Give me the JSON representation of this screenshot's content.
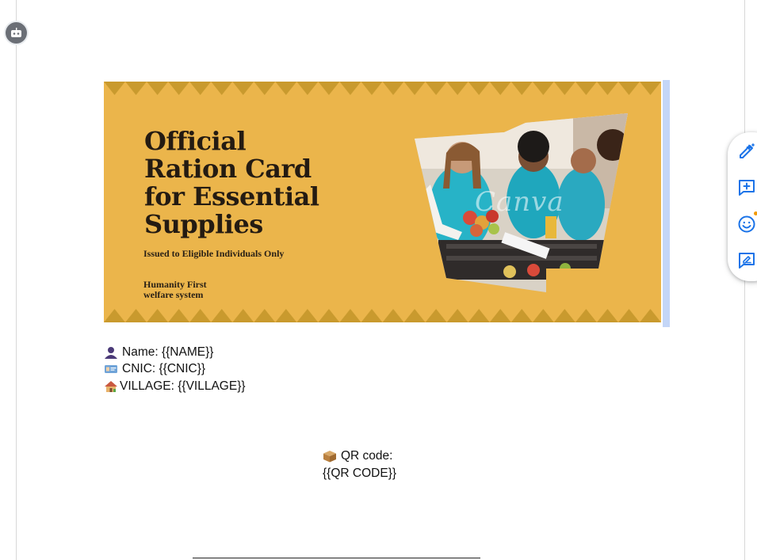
{
  "banner": {
    "title": "Official\nRation Card\nfor Essential\nSupplies",
    "subtitle": "Issued to Eligible Individuals Only",
    "organization": "Humanity First\nwelfare system",
    "watermark": "Canva",
    "background_color": "#ebb54b",
    "zigzag_color": "#c99a2e"
  },
  "fields": [
    {
      "icon": "person-silhouette-icon",
      "text": "Name: {{NAME}}"
    },
    {
      "icon": "id-card-icon",
      "text": "CNIC: {{CNIC}}"
    },
    {
      "icon": "house-icon",
      "text": "VILLAGE: {{VILLAGE}}"
    }
  ],
  "qr": {
    "icon": "package-icon",
    "label": "QR code:",
    "placeholder": "{{QR CODE}}"
  },
  "toolbar": {
    "items": [
      "edit-with-ai-icon",
      "add-comment-icon",
      "emoji-reaction-icon",
      "suggest-edits-icon"
    ],
    "accent_color": "#1a73e8"
  }
}
